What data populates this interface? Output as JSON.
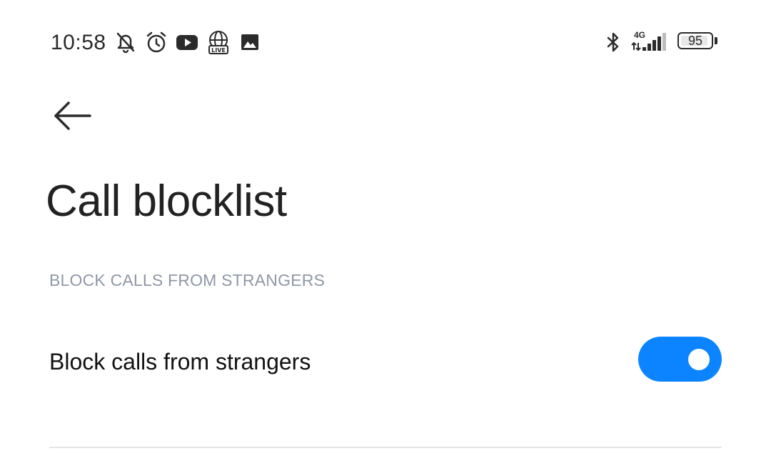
{
  "status_bar": {
    "time": "10:58",
    "icons": [
      "bell-off-icon",
      "alarm-clock-icon",
      "youtube-icon",
      "live-globe-icon",
      "image-icon",
      "bluetooth-icon",
      "signal-4g-icon"
    ],
    "live_badge": "LIVE",
    "network": "4G",
    "battery_level": "95",
    "battery_fraction": 0.95
  },
  "header": {
    "back_icon": "arrow-left-icon",
    "title": "Call blocklist"
  },
  "section": {
    "header": "BLOCK CALLS FROM STRANGERS"
  },
  "settings": [
    {
      "label": "Block calls from strangers",
      "enabled": true
    }
  ],
  "colors": {
    "accent": "#0d84ff",
    "section_header": "#8f98a6",
    "divider": "#e6e6e6"
  }
}
